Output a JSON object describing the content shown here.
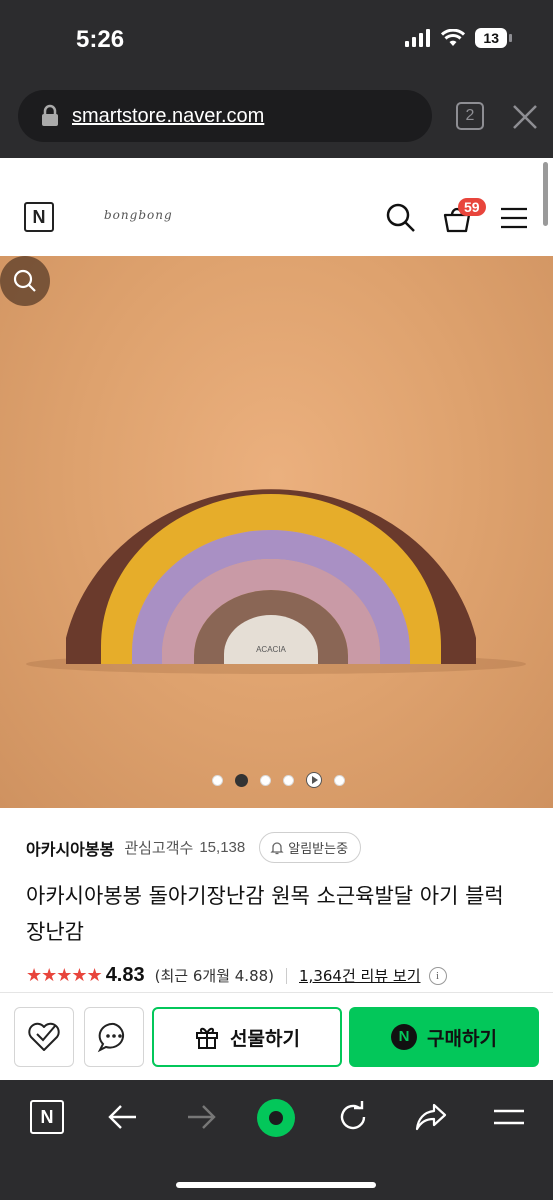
{
  "status_bar": {
    "time": "5:26",
    "battery": "13"
  },
  "browser": {
    "url": "smartstore.naver.com",
    "tab_count": "2"
  },
  "header": {
    "naver_logo": "N",
    "brand_logo": "bongbong",
    "cart_badge": "59"
  },
  "hero": {
    "block_label": "ACACIA",
    "slide_count": 6,
    "active_slide": 2
  },
  "product": {
    "store_name": "아카시아봉봉",
    "watcher_label": "관심고객수",
    "watcher_count": "15,138",
    "notify_label": "알림받는중",
    "title": "아카시아봉봉 돌아기장난감 원목 소근육발달 아기 블럭 장난감",
    "stars": "★★★★★",
    "rating": "4.83",
    "recent_rating": "(최근 6개월 4.88)",
    "review_link": "1,364건 리뷰 보기",
    "info_icon": "i"
  },
  "actions": {
    "gift_label": "선물하기",
    "buy_label": "구매하기",
    "buy_icon_text": "N"
  },
  "toolbar": {
    "naver_home": "N"
  },
  "colors": {
    "naver_green": "#03c75a",
    "badge_red": "#e8453c",
    "star_red": "#e8453c"
  }
}
